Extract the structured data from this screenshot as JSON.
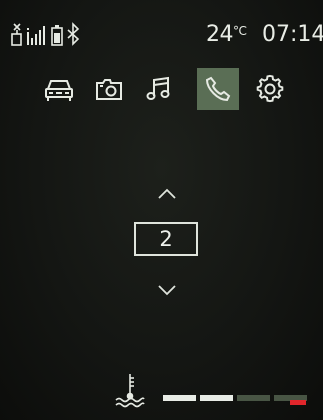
{
  "status": {
    "icons": [
      "antenna-icon",
      "signal-strength-icon",
      "battery-icon",
      "bluetooth-icon"
    ],
    "temperature": "24",
    "temperature_unit": "°C",
    "time": "07:14"
  },
  "nav": {
    "items": [
      {
        "name": "car",
        "icon": "car-icon",
        "active": false
      },
      {
        "name": "camera",
        "icon": "camera-icon",
        "active": false
      },
      {
        "name": "music",
        "icon": "music-note-icon",
        "active": false
      },
      {
        "name": "phone",
        "icon": "phone-icon",
        "active": true
      },
      {
        "name": "settings",
        "icon": "gear-icon",
        "active": false
      }
    ]
  },
  "selector": {
    "value": "2"
  },
  "coolant_gauge": {
    "icon": "coolant-temperature-icon",
    "segments_total": 4,
    "segments_lit": 2
  },
  "colors": {
    "accent": "#5a6e55",
    "warning": "#e0262b"
  }
}
